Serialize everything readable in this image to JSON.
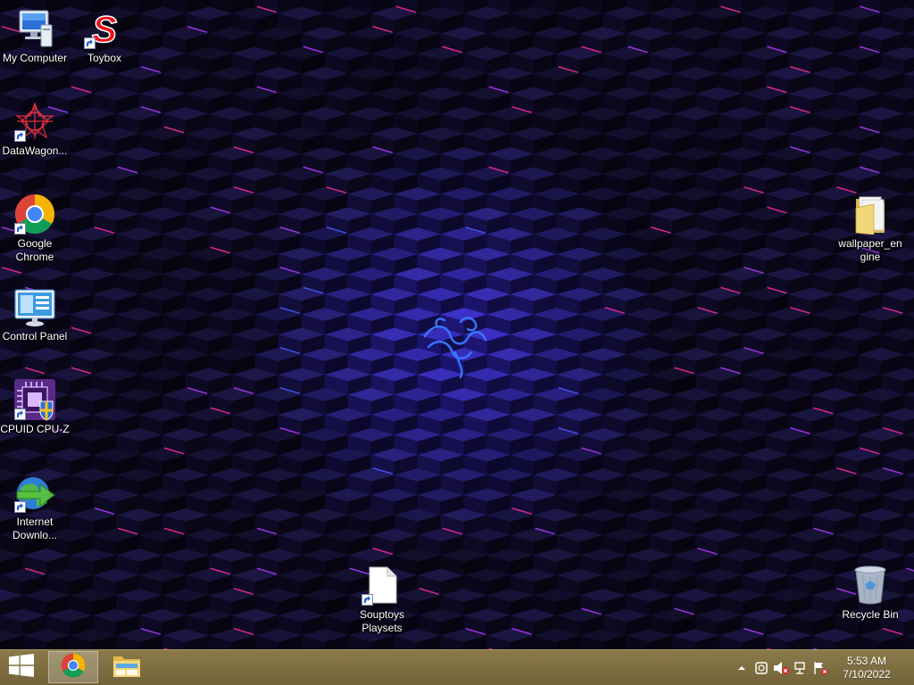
{
  "desktop": {
    "icons": [
      {
        "label": "My Computer",
        "icon": "computer-icon",
        "shortcut": false
      },
      {
        "label": "Toybox",
        "icon": "toybox-s-icon",
        "shortcut": true
      },
      {
        "label": "DataWagon...",
        "icon": "datawagon-star-icon",
        "shortcut": true
      },
      {
        "label": "Google\nChrome",
        "icon": "chrome-icon",
        "shortcut": true
      },
      {
        "label": "Control Panel",
        "icon": "control-panel-icon",
        "shortcut": false
      },
      {
        "label": "CPUID CPU-Z",
        "icon": "cpu-z-icon",
        "shortcut": true
      },
      {
        "label": "Internet\nDownlo...",
        "icon": "idm-globe-icon",
        "shortcut": true
      },
      {
        "label": "wallpaper_en\ngine",
        "icon": "folder-icon",
        "shortcut": false
      },
      {
        "label": "Souptoys\nPlaysets",
        "icon": "blank-file-icon",
        "shortcut": true
      },
      {
        "label": "Recycle Bin",
        "icon": "recycle-bin-icon",
        "shortcut": false
      }
    ]
  },
  "taskbar": {
    "start_icon": "windows-logo-icon",
    "pinned": [
      {
        "name": "Google Chrome",
        "icon": "chrome-icon",
        "active": true
      },
      {
        "name": "File Explorer",
        "icon": "file-explorer-icon",
        "active": false
      }
    ],
    "tray_icons": [
      "chevron-up-icon",
      "action-center-icon",
      "volume-muted-icon",
      "network-icon",
      "flag-alert-icon"
    ],
    "clock": {
      "time": "5:53 AM",
      "date": "7/10/2022"
    }
  },
  "colors": {
    "taskbar": "#7e6e42",
    "wallpaper_glow": "#2850ff",
    "accent_magenta": "#ff2a9a"
  }
}
